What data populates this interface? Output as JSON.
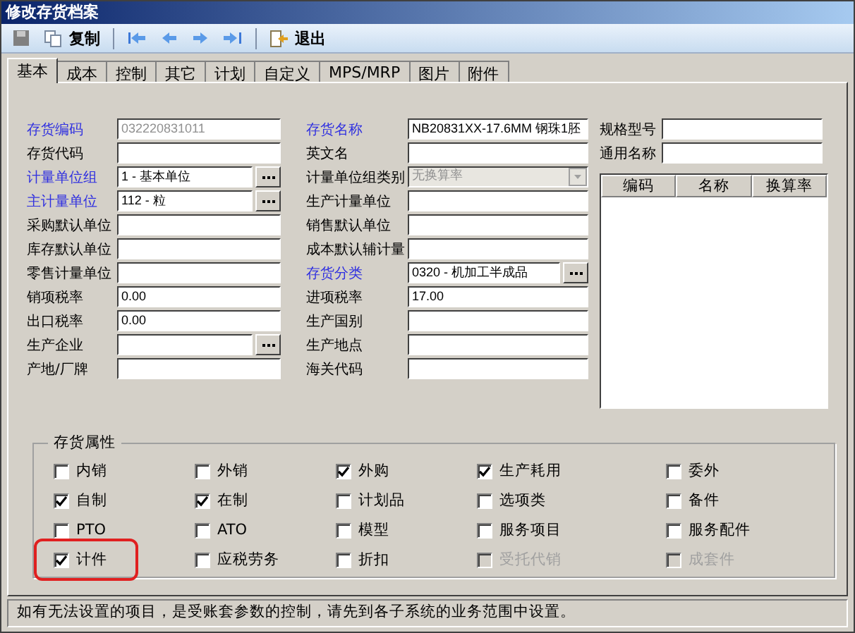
{
  "window": {
    "title": "修改存货档案"
  },
  "toolbar": [
    {
      "kind": "save",
      "disabled": true
    },
    {
      "kind": "copy",
      "label": "复制",
      "disabled": false
    },
    {
      "kind": "separator"
    },
    {
      "kind": "first",
      "disabled": false
    },
    {
      "kind": "prev",
      "disabled": false
    },
    {
      "kind": "next",
      "disabled": false
    },
    {
      "kind": "last",
      "disabled": false
    },
    {
      "kind": "separator"
    },
    {
      "kind": "exit",
      "label": "退出",
      "disabled": false
    }
  ],
  "tabs": [
    {
      "label": "基本",
      "selected": true
    },
    {
      "label": "成本",
      "selected": false
    },
    {
      "label": "控制",
      "selected": false
    },
    {
      "label": "其它",
      "selected": false
    },
    {
      "label": "计划",
      "selected": false
    },
    {
      "label": "自定义",
      "selected": false
    },
    {
      "label": "MPS/MRP",
      "selected": false
    },
    {
      "label": "图片",
      "selected": false
    },
    {
      "label": "附件",
      "selected": false
    }
  ],
  "left_fields": [
    {
      "label": "存货编码",
      "required": true,
      "kind": "text",
      "value": "032220831011",
      "disabled": true
    },
    {
      "label": "存货代码",
      "required": false,
      "kind": "text"
    },
    {
      "label": "计量单位组",
      "required": true,
      "kind": "lookup",
      "value": "1 - 基本单位"
    },
    {
      "label": "主计量单位",
      "required": true,
      "kind": "lookup",
      "value": "112 - 粒"
    },
    {
      "label": "采购默认单位",
      "required": false,
      "kind": "text"
    },
    {
      "label": "库存默认单位",
      "required": false,
      "kind": "text"
    },
    {
      "label": "零售计量单位",
      "required": false,
      "kind": "text"
    },
    {
      "label": "销项税率",
      "required": false,
      "kind": "text",
      "value": "0.00"
    },
    {
      "label": "出口税率",
      "required": false,
      "kind": "text",
      "value": "0.00"
    },
    {
      "label": "生产企业",
      "required": false,
      "kind": "lookup"
    },
    {
      "label": "产地/厂牌",
      "required": false,
      "kind": "text"
    }
  ],
  "middle_fields": [
    {
      "label": "存货名称",
      "required": true,
      "kind": "text",
      "value": "NB20831XX-17.6MM 钢珠1胚"
    },
    {
      "label": "英文名",
      "required": false,
      "kind": "text"
    },
    {
      "label": "计量单位组类别",
      "required": false,
      "kind": "dropdown",
      "value": "无换算率",
      "disabled": true
    },
    {
      "label": "生产计量单位",
      "required": false,
      "kind": "text"
    },
    {
      "label": "销售默认单位",
      "required": false,
      "kind": "text"
    },
    {
      "label": "成本默认辅计量",
      "required": false,
      "kind": "text"
    },
    {
      "label": "存货分类",
      "required": true,
      "kind": "lookup",
      "value": "0320 - 机加工半成品"
    },
    {
      "label": "进项税率",
      "required": false,
      "kind": "text",
      "value": "17.00"
    },
    {
      "label": "生产国别",
      "required": false,
      "kind": "text"
    },
    {
      "label": "生产地点",
      "required": false,
      "kind": "text"
    },
    {
      "label": "海关代码",
      "required": false,
      "kind": "text"
    }
  ],
  "right_fields": [
    {
      "label": "规格型号"
    },
    {
      "label": "通用名称"
    }
  ],
  "unit_table": {
    "columns": [
      "编码",
      "名称",
      "换算率"
    ]
  },
  "attributes": {
    "title": "存货属性",
    "items": [
      {
        "label": "内销",
        "checked": false,
        "disabled": false,
        "highlighted": false
      },
      {
        "label": "外销",
        "checked": false,
        "disabled": false,
        "highlighted": false
      },
      {
        "label": "外购",
        "checked": true,
        "disabled": false,
        "highlighted": false
      },
      {
        "label": "生产耗用",
        "checked": true,
        "disabled": false,
        "highlighted": false
      },
      {
        "label": "委外",
        "checked": false,
        "disabled": false,
        "highlighted": false
      },
      {
        "label": "自制",
        "checked": true,
        "disabled": false,
        "highlighted": false
      },
      {
        "label": "在制",
        "checked": true,
        "disabled": false,
        "highlighted": false
      },
      {
        "label": "计划品",
        "checked": false,
        "disabled": false,
        "highlighted": false
      },
      {
        "label": "选项类",
        "checked": false,
        "disabled": false,
        "highlighted": false
      },
      {
        "label": "备件",
        "checked": false,
        "disabled": false,
        "highlighted": false
      },
      {
        "label": "PTO",
        "checked": false,
        "disabled": false,
        "highlighted": false
      },
      {
        "label": "ATO",
        "checked": false,
        "disabled": false,
        "highlighted": false
      },
      {
        "label": "模型",
        "checked": false,
        "disabled": false,
        "highlighted": false
      },
      {
        "label": "服务项目",
        "checked": false,
        "disabled": false,
        "highlighted": false
      },
      {
        "label": "服务配件",
        "checked": false,
        "disabled": false,
        "highlighted": false
      },
      {
        "label": "计件",
        "checked": true,
        "disabled": false,
        "highlighted": true
      },
      {
        "label": "应税劳务",
        "checked": false,
        "disabled": false,
        "highlighted": false
      },
      {
        "label": "折扣",
        "checked": false,
        "disabled": false,
        "highlighted": false
      },
      {
        "label": "受托代销",
        "checked": false,
        "disabled": true,
        "highlighted": false
      },
      {
        "label": "成套件",
        "checked": false,
        "disabled": true,
        "highlighted": false
      }
    ]
  },
  "status_bar": "如有无法设置的项目，是受账套参数的控制，请先到各子系统的业务范围中设置。"
}
